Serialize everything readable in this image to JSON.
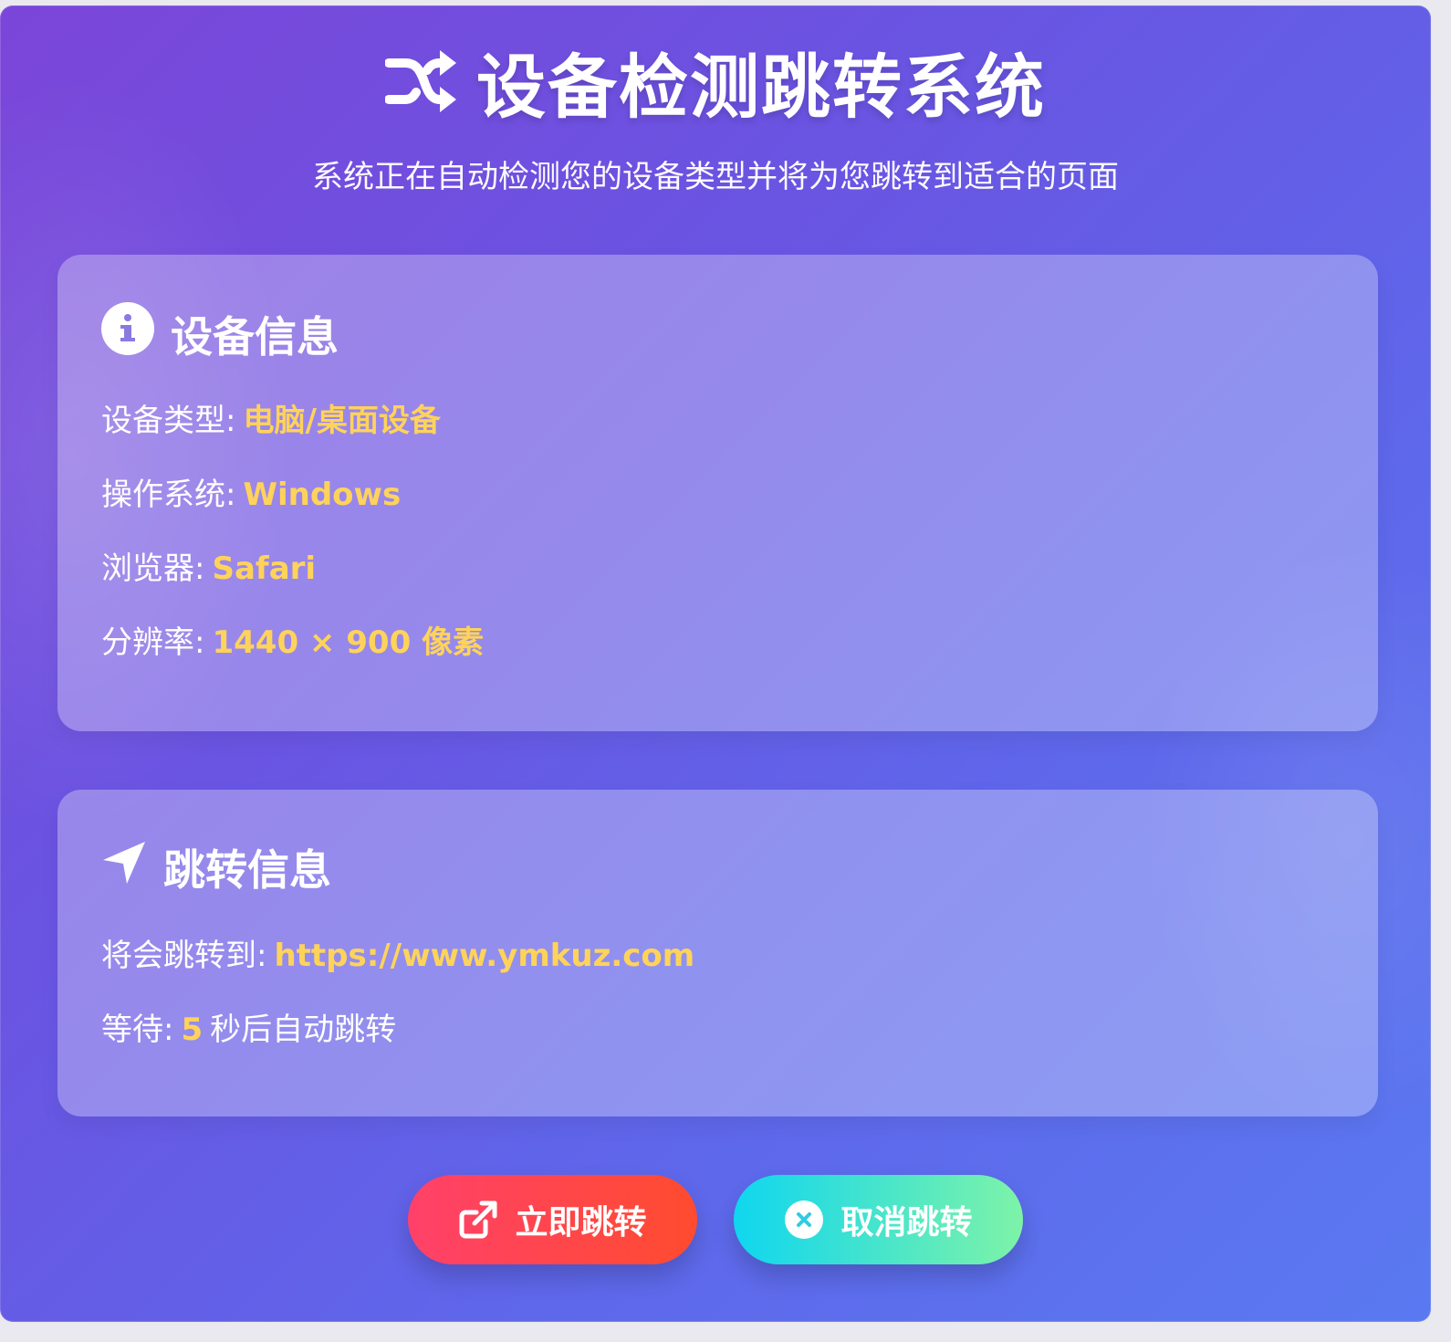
{
  "header": {
    "title": "设备检测跳转系统",
    "subtitle": "系统正在自动检测您的设备类型并将为您跳转到适合的页面"
  },
  "device_card": {
    "title": "设备信息",
    "rows": [
      {
        "label": "设备类型:",
        "value": "电脑/桌面设备"
      },
      {
        "label": "操作系统:",
        "value": "Windows"
      },
      {
        "label": "浏览器:",
        "value": "Safari"
      },
      {
        "label": "分辨率:",
        "value": "1440 × 900 像素"
      }
    ]
  },
  "redirect_card": {
    "title": "跳转信息",
    "target": {
      "label": "将会跳转到:",
      "value": "https://www.ymkuz.com"
    },
    "countdown": {
      "label": "等待:",
      "value": "5",
      "suffix": "秒后自动跳转"
    }
  },
  "buttons": {
    "go": {
      "label": "立即跳转",
      "icon": "external-link-icon"
    },
    "cancel": {
      "label": "取消跳转",
      "icon": "close-circle-icon"
    }
  },
  "colors": {
    "highlight": "#ffd35a",
    "go_gradient_start": "#ff416a",
    "go_gradient_end": "#ff4b2f",
    "cancel_gradient_start": "#0fd6ef",
    "cancel_gradient_end": "#7ef3a8"
  },
  "icons": {
    "title": "shuffle-icon",
    "device_card": "info-circle-icon",
    "redirect_card": "location-arrow-icon"
  }
}
